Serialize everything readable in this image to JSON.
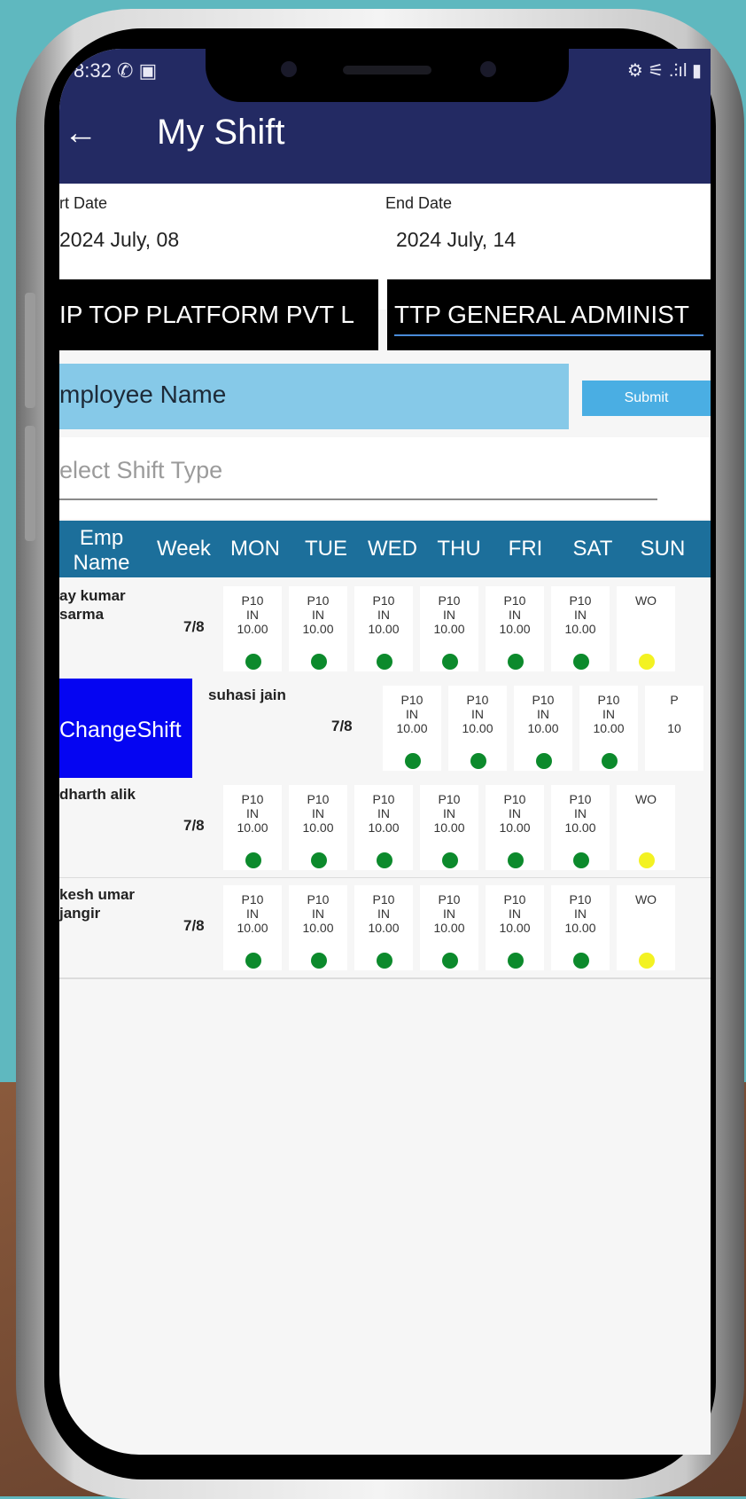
{
  "status": {
    "time": "8:32",
    "icons_left": "✆ ▣",
    "icons_right": "⚙ ⚟ .⫶ıl ▮"
  },
  "header": {
    "title": "My Shift"
  },
  "dates": {
    "start_label": "rt Date",
    "start_value": "2024 July, 08",
    "end_label": "End Date",
    "end_value": "2024 July, 14"
  },
  "dropdowns": {
    "company": "IP TOP PLATFORM PVT L",
    "department": "TTP GENERAL ADMINIST"
  },
  "employee_field": {
    "placeholder": "mployee Name"
  },
  "submit_label": "Submit",
  "shift_type": {
    "placeholder": "elect Shift Type"
  },
  "table": {
    "headers": {
      "name": "Emp Name",
      "week": "Week",
      "days": [
        "MON",
        "TUE",
        "WED",
        "THU",
        "FRI",
        "SAT",
        "SUN"
      ]
    },
    "rows": [
      {
        "name": "ay kumar sarma",
        "week": "7/8",
        "cells": [
          {
            "l1": "P10",
            "l2": "IN",
            "l3": "10.00",
            "status": "green"
          },
          {
            "l1": "P10",
            "l2": "IN",
            "l3": "10.00",
            "status": "green"
          },
          {
            "l1": "P10",
            "l2": "IN",
            "l3": "10.00",
            "status": "green"
          },
          {
            "l1": "P10",
            "l2": "IN",
            "l3": "10.00",
            "status": "green"
          },
          {
            "l1": "P10",
            "l2": "IN",
            "l3": "10.00",
            "status": "green"
          },
          {
            "l1": "P10",
            "l2": "IN",
            "l3": "10.00",
            "status": "green"
          },
          {
            "l1": "WO",
            "l2": "",
            "l3": "",
            "status": "yellow"
          }
        ]
      },
      {
        "name": "suhasi jain",
        "week": "7/8",
        "change_label": "ChangeShift",
        "cells": [
          {
            "l1": "P10",
            "l2": "IN",
            "l3": "10.00",
            "status": "green"
          },
          {
            "l1": "P10",
            "l2": "IN",
            "l3": "10.00",
            "status": "green"
          },
          {
            "l1": "P10",
            "l2": "IN",
            "l3": "10.00",
            "status": "green"
          },
          {
            "l1": "P10",
            "l2": "IN",
            "l3": "10.00",
            "status": "green"
          },
          {
            "l1": "P",
            "l2": "",
            "l3": "10",
            "status": ""
          }
        ]
      },
      {
        "name": "dharth alik",
        "week": "7/8",
        "cells": [
          {
            "l1": "P10",
            "l2": "IN",
            "l3": "10.00",
            "status": "green"
          },
          {
            "l1": "P10",
            "l2": "IN",
            "l3": "10.00",
            "status": "green"
          },
          {
            "l1": "P10",
            "l2": "IN",
            "l3": "10.00",
            "status": "green"
          },
          {
            "l1": "P10",
            "l2": "IN",
            "l3": "10.00",
            "status": "green"
          },
          {
            "l1": "P10",
            "l2": "IN",
            "l3": "10.00",
            "status": "green"
          },
          {
            "l1": "P10",
            "l2": "IN",
            "l3": "10.00",
            "status": "green"
          },
          {
            "l1": "WO",
            "l2": "",
            "l3": "",
            "status": "yellow"
          }
        ]
      },
      {
        "name": "kesh umar jangir",
        "week": "7/8",
        "cells": [
          {
            "l1": "P10",
            "l2": "IN",
            "l3": "10.00",
            "status": "green"
          },
          {
            "l1": "P10",
            "l2": "IN",
            "l3": "10.00",
            "status": "green"
          },
          {
            "l1": "P10",
            "l2": "IN",
            "l3": "10.00",
            "status": "green"
          },
          {
            "l1": "P10",
            "l2": "IN",
            "l3": "10.00",
            "status": "green"
          },
          {
            "l1": "P10",
            "l2": "IN",
            "l3": "10.00",
            "status": "green"
          },
          {
            "l1": "P10",
            "l2": "IN",
            "l3": "10.00",
            "status": "green"
          },
          {
            "l1": "WO",
            "l2": "",
            "l3": "",
            "status": "yellow"
          }
        ]
      }
    ]
  },
  "colors": {
    "header": "#232a63",
    "table_header": "#1c6f9b",
    "present": "#0c8a2c",
    "week_off": "#f3f222",
    "change_shift": "#0505f2"
  }
}
